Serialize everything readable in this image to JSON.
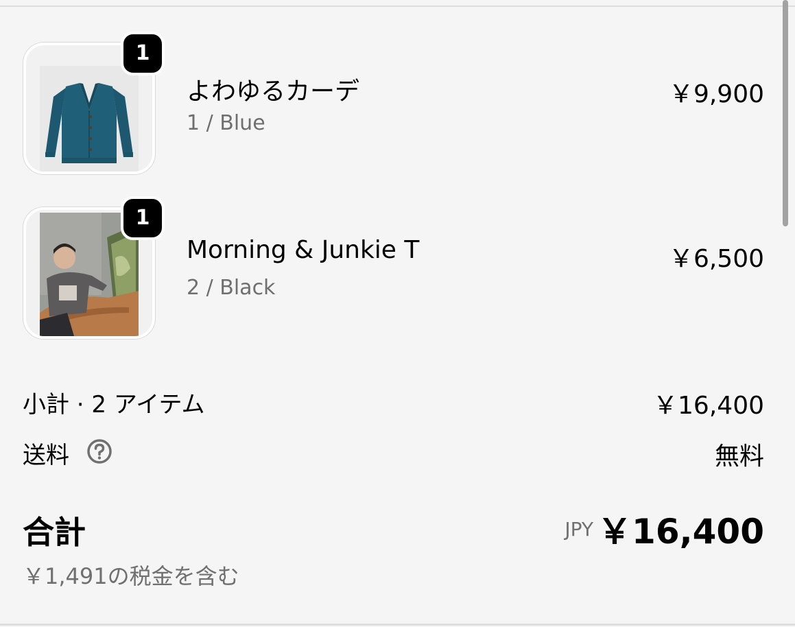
{
  "line_items": [
    {
      "quantity": "1",
      "title": "よわゆるカーデ",
      "variant": "1 / Blue",
      "price": "￥9,900",
      "thumbnail": "blue-cardigan-image"
    },
    {
      "quantity": "1",
      "title": "Morning & Junkie T",
      "variant": "2 / Black",
      "price": "￥6,500",
      "thumbnail": "model-on-sofa-photo"
    }
  ],
  "summary": {
    "subtotal_label": "小計 · 2 アイテム",
    "subtotal_value": "￥16,400",
    "shipping_label": "送料",
    "shipping_value": "無料",
    "total_label": "合計",
    "currency_code": "JPY",
    "total_value": "￥16,400",
    "tax_note": "￥1,491の税金を含む"
  },
  "icons": {
    "shipping_help": "question-circle-icon"
  },
  "colors": {
    "background": "#f5f5f5",
    "badge": "#000000",
    "muted_text": "#6f6f6f"
  }
}
